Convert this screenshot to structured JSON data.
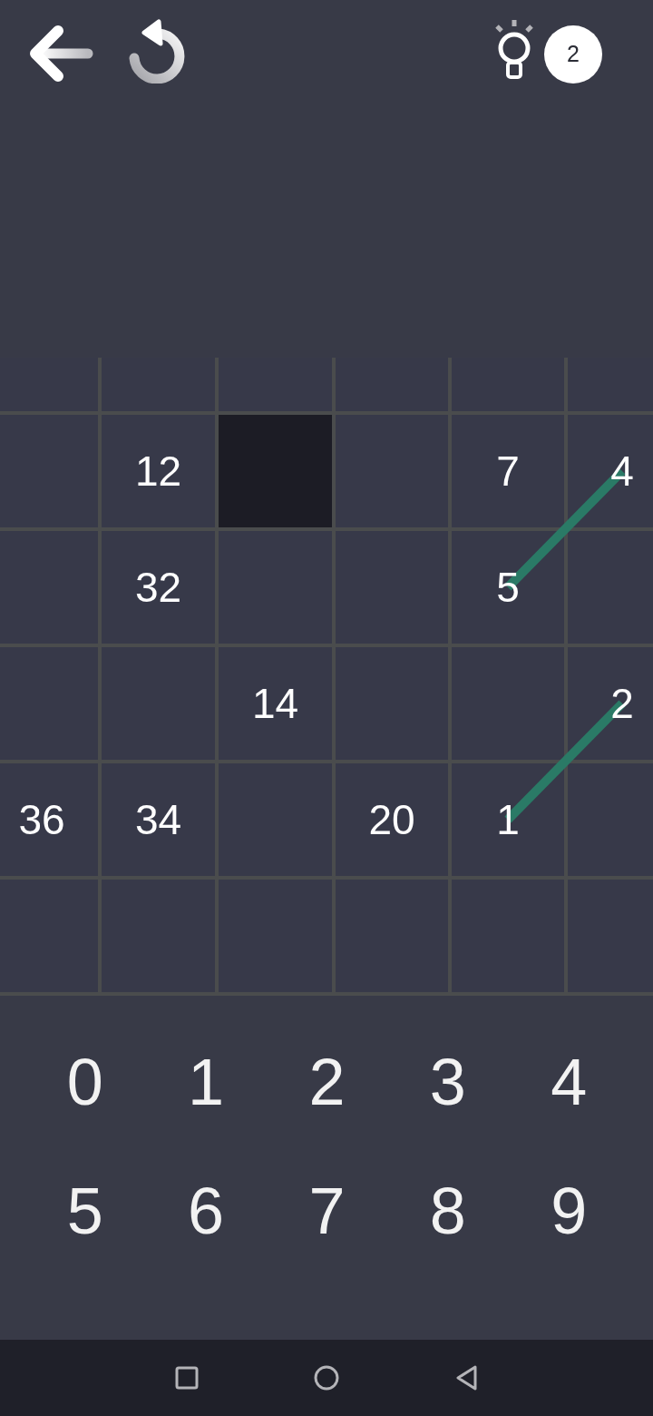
{
  "toolbar": {
    "hint_count": "2"
  },
  "grid": {
    "rows": [
      {
        "cells": [
          {
            "kind": "empty"
          },
          {
            "kind": "empty"
          },
          {
            "kind": "empty"
          },
          {
            "kind": "empty"
          },
          {
            "kind": "empty"
          },
          {
            "kind": "empty"
          }
        ]
      },
      {
        "cells": [
          {
            "kind": "empty"
          },
          {
            "kind": "number",
            "value": "12"
          },
          {
            "kind": "blocked"
          },
          {
            "kind": "empty"
          },
          {
            "kind": "number",
            "value": "7"
          },
          {
            "kind": "number",
            "value": "4",
            "linked_lower_left": true
          }
        ]
      },
      {
        "cells": [
          {
            "kind": "empty"
          },
          {
            "kind": "number",
            "value": "32"
          },
          {
            "kind": "empty"
          },
          {
            "kind": "empty"
          },
          {
            "kind": "number",
            "value": "5"
          },
          {
            "kind": "empty"
          }
        ]
      },
      {
        "cells": [
          {
            "kind": "empty"
          },
          {
            "kind": "empty"
          },
          {
            "kind": "number",
            "value": "14"
          },
          {
            "kind": "empty"
          },
          {
            "kind": "empty"
          },
          {
            "kind": "number",
            "value": "2",
            "linked_lower_left": true
          }
        ]
      },
      {
        "cells": [
          {
            "kind": "number",
            "value": "36"
          },
          {
            "kind": "number",
            "value": "34"
          },
          {
            "kind": "empty"
          },
          {
            "kind": "number",
            "value": "20"
          },
          {
            "kind": "number",
            "value": "1"
          },
          {
            "kind": "empty"
          }
        ]
      },
      {
        "cells": [
          {
            "kind": "empty"
          },
          {
            "kind": "empty"
          },
          {
            "kind": "empty"
          },
          {
            "kind": "empty"
          },
          {
            "kind": "empty"
          },
          {
            "kind": "empty"
          }
        ]
      }
    ]
  },
  "keypad": {
    "keys": [
      "0",
      "1",
      "2",
      "3",
      "4",
      "5",
      "6",
      "7",
      "8",
      "9"
    ]
  }
}
